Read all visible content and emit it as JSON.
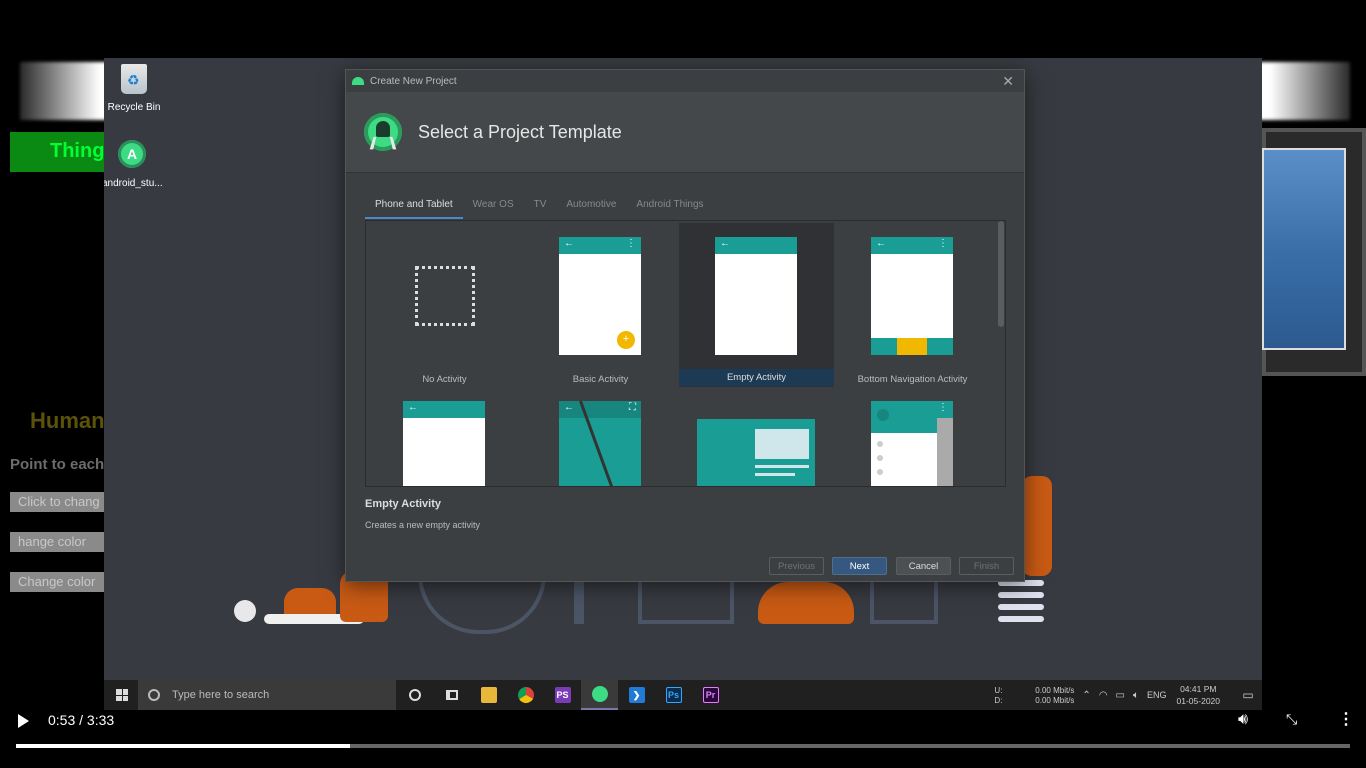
{
  "background_page": {
    "green_button": "Thing",
    "heading": "Human",
    "instruction": "Point to each",
    "buttons": [
      "Click to chang",
      "hange color",
      "Change color"
    ]
  },
  "desktop": {
    "icons": [
      {
        "label": "Recycle Bin",
        "icon": "recycle-bin-icon"
      },
      {
        "label": "android_stu...",
        "icon": "android-studio-icon"
      }
    ]
  },
  "dialog": {
    "window_title": "Create New Project",
    "header_title": "Select a Project Template",
    "tabs": [
      {
        "label": "Phone and Tablet",
        "active": true
      },
      {
        "label": "Wear OS",
        "active": false
      },
      {
        "label": "TV",
        "active": false
      },
      {
        "label": "Automotive",
        "active": false
      },
      {
        "label": "Android Things",
        "active": false
      }
    ],
    "templates": [
      {
        "label": "No Activity"
      },
      {
        "label": "Basic Activity"
      },
      {
        "label": "Empty Activity",
        "selected": true
      },
      {
        "label": "Bottom Navigation Activity"
      }
    ],
    "description_title": "Empty Activity",
    "description_text": "Creates a new empty activity",
    "buttons": {
      "previous": "Previous",
      "next": "Next",
      "cancel": "Cancel",
      "finish": "Finish"
    }
  },
  "taskbar": {
    "search_placeholder": "Type here to search",
    "apps": [
      "cortana-icon",
      "task-view-icon",
      "file-explorer-icon",
      "chrome-icon",
      "phpstorm-icon",
      "android-studio-icon",
      "vscode-icon",
      "photoshop-icon",
      "premiere-icon"
    ],
    "net_up_label": "U:",
    "net_down_label": "D:",
    "net_up": "0.00 Mbit/s",
    "net_down": "0.00 Mbit/s",
    "language": "ENG",
    "time": "04:41 PM",
    "date": "01-05-2020"
  },
  "player": {
    "time": "0:53 / 3:33",
    "progress": 0.25
  },
  "colors": {
    "accent_teal": "#1a9d94",
    "fab_yellow": "#f2b800",
    "android_green": "#3ddc84",
    "primary_button": "#365880"
  }
}
